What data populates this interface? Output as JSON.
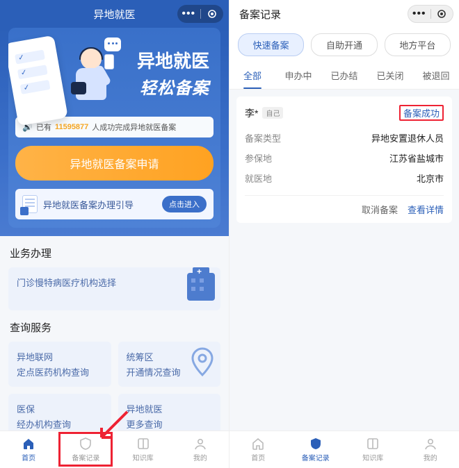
{
  "left": {
    "header": {
      "title": "异地就医"
    },
    "hero": {
      "line1": "异地就医",
      "line2": "轻松备案"
    },
    "stat": {
      "prefix": "已有",
      "count": "11595877",
      "suffix": "人成功完成异地就医备案"
    },
    "apply_btn": "异地就医备案申请",
    "guide": {
      "text": "异地就医备案办理引导",
      "btn": "点击进入"
    },
    "section_biz": "业务办理",
    "tile_biz": "门诊慢特病医疗机构选择",
    "section_query": "查询服务",
    "q_tiles": [
      {
        "t1": "异地联网",
        "t2": "定点医药机构查询"
      },
      {
        "t1": "统筹区",
        "t2": "开通情况查询"
      },
      {
        "t1": "医保",
        "t2": "经办机构查询"
      },
      {
        "t1": "异地就医",
        "t2": "更多查询"
      }
    ],
    "tabbar": [
      "首页",
      "备案记录",
      "知识库",
      "我的"
    ]
  },
  "right": {
    "header": {
      "title": "备案记录"
    },
    "pills": [
      "快速备案",
      "自助开通",
      "地方平台"
    ],
    "tabs": [
      "全部",
      "申办中",
      "已办结",
      "已关闭",
      "被退回"
    ],
    "card": {
      "name": "李*",
      "self_tag": "自己",
      "status": "备案成功",
      "rows": [
        {
          "k": "备案类型",
          "v": "异地安置退休人员"
        },
        {
          "k": "参保地",
          "v": "江苏省盐城市"
        },
        {
          "k": "就医地",
          "v": "北京市"
        }
      ],
      "cancel": "取消备案",
      "detail": "查看详情"
    },
    "tabbar": [
      "首页",
      "备案记录",
      "知识库",
      "我的"
    ]
  }
}
